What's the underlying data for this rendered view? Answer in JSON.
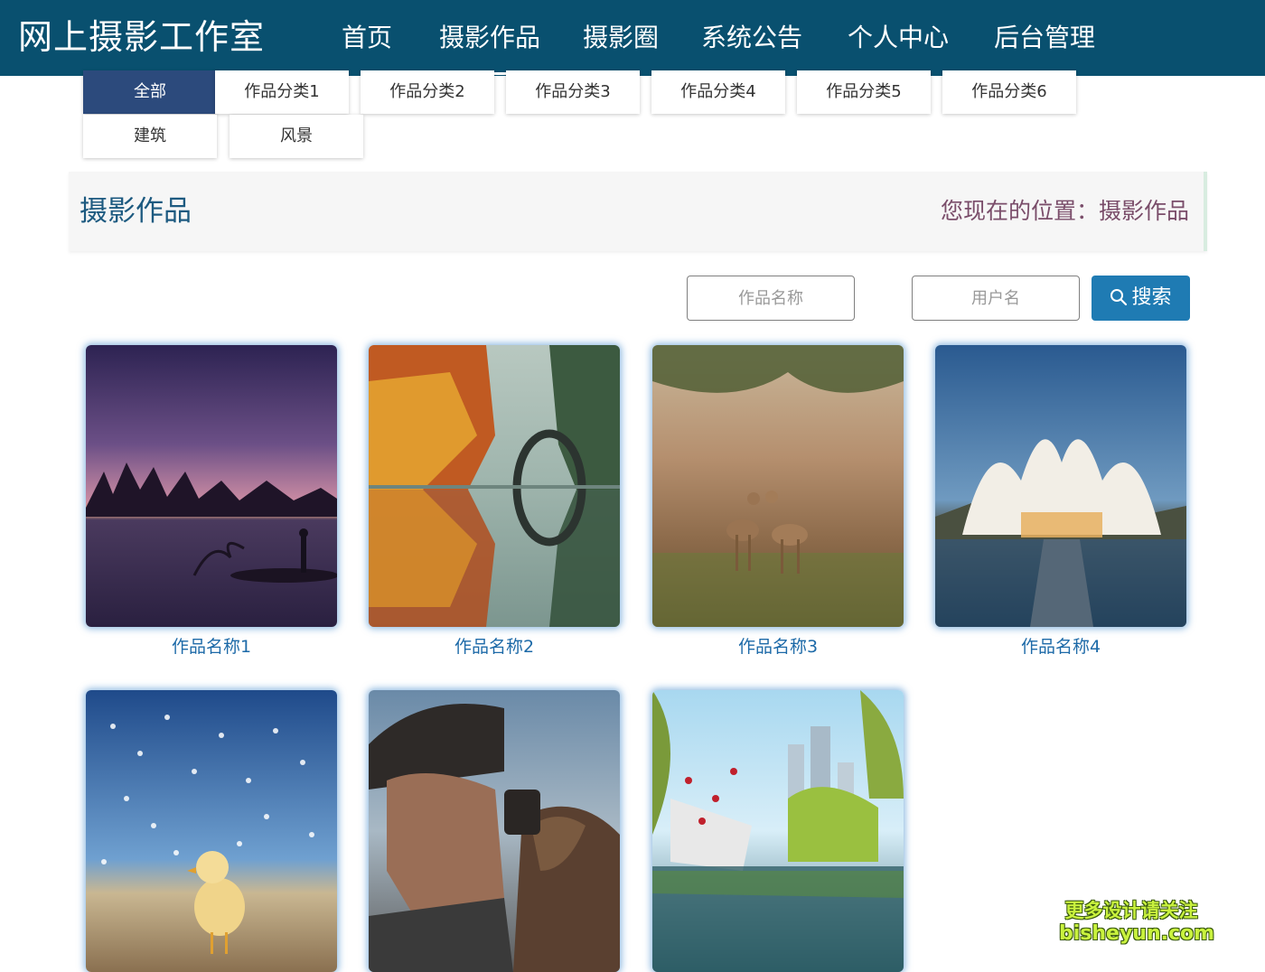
{
  "header": {
    "brand": "网上摄影工作室",
    "nav": [
      {
        "label": "首页"
      },
      {
        "label": "摄影作品",
        "active": true
      },
      {
        "label": "摄影圈"
      },
      {
        "label": "系统公告"
      },
      {
        "label": "个人中心"
      },
      {
        "label": "后台管理"
      }
    ]
  },
  "categories": [
    {
      "label": "全部",
      "active": true
    },
    {
      "label": "作品分类1"
    },
    {
      "label": "作品分类2"
    },
    {
      "label": "作品分类3"
    },
    {
      "label": "作品分类4"
    },
    {
      "label": "作品分类5"
    },
    {
      "label": "作品分类6"
    },
    {
      "label": "建筑"
    },
    {
      "label": "风景"
    }
  ],
  "section": {
    "title": "摄影作品",
    "location": "您现在的位置：摄影作品"
  },
  "search": {
    "name_placeholder": "作品名称",
    "user_placeholder": "用户名",
    "button_label": "搜索"
  },
  "works": [
    {
      "caption": "作品名称1"
    },
    {
      "caption": "作品名称2"
    },
    {
      "caption": "作品名称3"
    },
    {
      "caption": "作品名称4"
    },
    {
      "caption": ""
    },
    {
      "caption": ""
    },
    {
      "caption": ""
    }
  ],
  "watermark": {
    "line1": "更多设计请关注",
    "line2": "bisheyun.com"
  },
  "colors": {
    "header_bg": "#09506f",
    "active_category": "#2c4a7c",
    "search_button": "#1f7bb3",
    "caption": "#1d6aa8"
  }
}
